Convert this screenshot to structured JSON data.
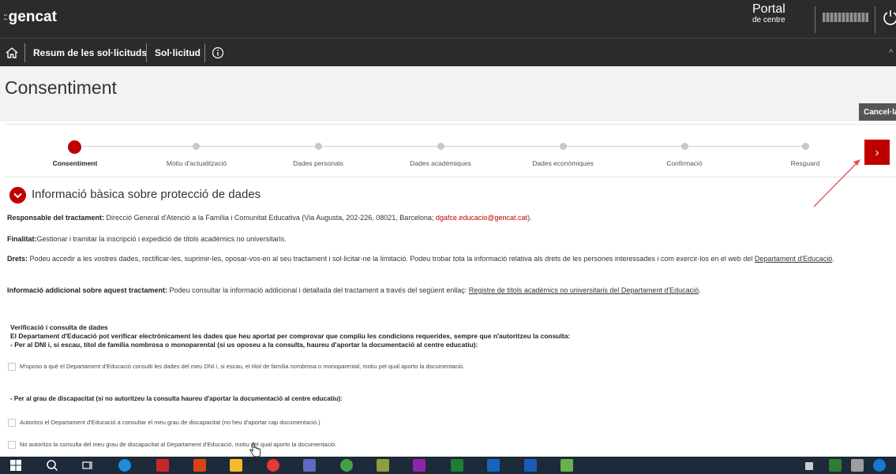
{
  "header": {
    "brand_mark": "::",
    "brand": "gencat",
    "portal_title": "Portal",
    "portal_subtitle": "de centre"
  },
  "nav": {
    "home_icon": "home-icon",
    "items": [
      "Resum de les sol·licituds",
      "Sol·licitud"
    ],
    "info_icon": "info-icon"
  },
  "page": {
    "title": "Consentiment",
    "cancel_label": "Cancel·la",
    "next_icon": "chevron-right-icon",
    "next_label": "›"
  },
  "stepper": {
    "current_step": 0,
    "steps": [
      "Consentiment",
      "Motiu d'actualització",
      "Dades personals",
      "Dades acadèmiques",
      "Dades econòmiques",
      "Confirmació",
      "Resguard"
    ]
  },
  "section": {
    "title": "Informació bàsica sobre protecció de dades",
    "responsable_label": "Responsable del tractament:",
    "responsable_text": " Direcció General d'Atenció a la Família i Comunitat Educativa (Via Augusta, 202-226, 08021, Barcelona; ",
    "responsable_email": "dgafce.educacio@gencat.cat",
    "responsable_end": ").",
    "finalitat_label": "Finalitat:",
    "finalitat_text": "Gestionar i tramitar la inscripció i expedició de títols acadèmics no universitaris.",
    "drets_label": "Drets:",
    "drets_text": " Podeu accedir a les vostres dades, rectificar-les, suprimir-les, oposar-vos-en al seu tractament i sol·licitar-ne la limitació. Podeu trobar tota la informació relativa als drets de les persones interessades i com exercir-los en el  web del ",
    "drets_link": "Departament d'Educació",
    "drets_end": ".",
    "info_label": "Informació addicional sobre aquest tractament:",
    "info_text": " Podeu consultar la informació addicional i detallada del tractament a través del següent enllaç: ",
    "info_link": "Registre de títols acadèmics no universitaris del Departament d'Educació",
    "info_end": "."
  },
  "verification": {
    "title": "Verificació i consulta de dades",
    "intro": "El Departament d'Educació pot verificar electrònicament les dades que heu aportat per comprovar que compliu les condicions requerides, sempre que n'autoritzeu la consulta:",
    "dni_heading": "- Per al DNI i, si escau, títol de família nombrosa o monoparental (si us oposeu a la consulta, haureu d'aportar la documentació al centre educatiu):",
    "dni_option": "M'oposo a què el Departament d'Educació consulti les dades del meu DNI i, si escau, el títol de família nombrosa o monoparental, motiu pel qual aporto la documentació.",
    "disc_heading": "- Per al grau de discapacitat (si no autoritzeu la consulta haureu d'aportar la documentació al centre educatiu):",
    "disc_option_1": "Autoritzo el Departament d'Educació a consultar el meu grau de discapacitat (no heu d'aportar cap documentació.)",
    "disc_option_2": "No autoritzo la consulta del meu grau de discapacitat al Departament d'Educació, motiu pel qual aporto la documentació."
  },
  "colors": {
    "accent": "#c00000",
    "header_bg": "#2b2b2b",
    "title_bg": "#f2f2f2",
    "taskbar_bg": "#1c2a39"
  }
}
